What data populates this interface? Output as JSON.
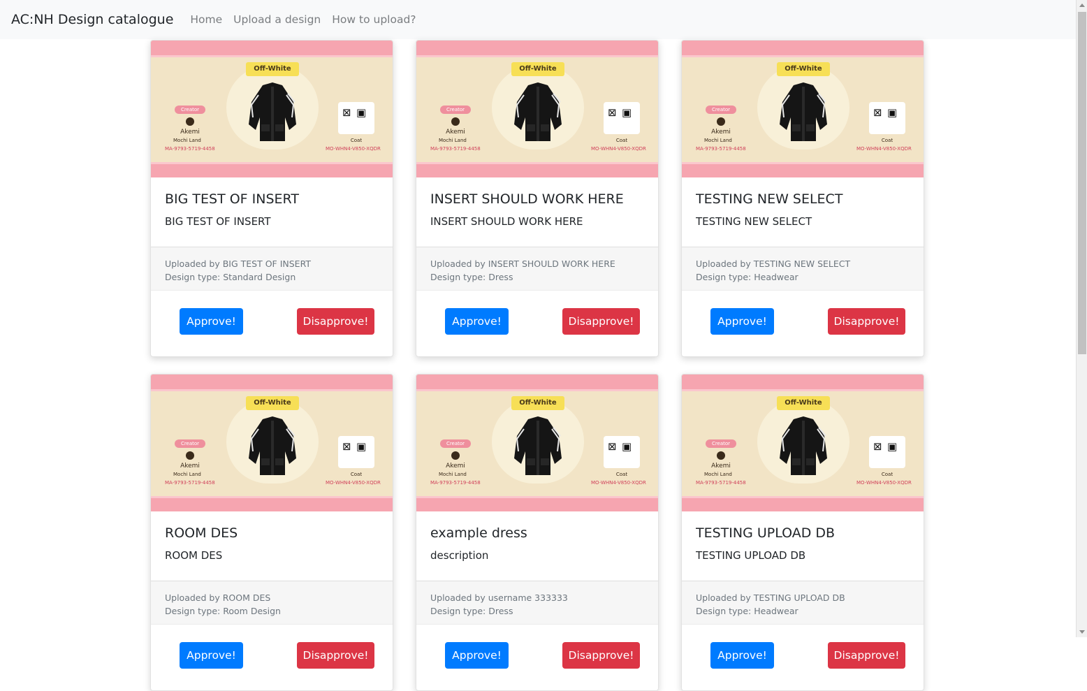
{
  "navbar": {
    "brand": "AC:NH Design catalogue",
    "links": [
      "Home",
      "Upload a design",
      "How to upload?"
    ]
  },
  "design_preview": {
    "brand_tag": "Off-White",
    "creator_label": "Creator",
    "creator_name": "Akemi",
    "island": "Mochi Land",
    "creator_id": "MA-9793-5719-4458",
    "item_type": "Coat",
    "item_id": "MO-WHN4-V850-XQDR"
  },
  "labels": {
    "uploaded_by_prefix": "Uploaded by ",
    "design_type_prefix": "Design type: "
  },
  "buttons": {
    "approve": "Approve!",
    "disapprove": "Disapprove!"
  },
  "colors": {
    "approve": "#007bff",
    "disapprove": "#dc3545",
    "navbar_bg": "#f8f9fa",
    "preview_band": "#f6a5b0",
    "preview_bg": "#f2e4c6"
  },
  "cards": [
    {
      "title": "BIG TEST OF INSERT",
      "description": "BIG TEST OF INSERT",
      "uploader": "BIG TEST OF INSERT",
      "design_type": "Standard Design"
    },
    {
      "title": "INSERT SHOULD WORK HERE",
      "description": "INSERT SHOULD WORK HERE",
      "uploader": "INSERT SHOULD WORK HERE",
      "design_type": "Dress"
    },
    {
      "title": "TESTING NEW SELECT",
      "description": "TESTING NEW SELECT",
      "uploader": "TESTING NEW SELECT",
      "design_type": "Headwear"
    },
    {
      "title": "ROOM DES",
      "description": "ROOM DES",
      "uploader": "ROOM DES",
      "design_type": "Room Design"
    },
    {
      "title": "example dress",
      "description": "description",
      "uploader": "username 333333",
      "design_type": "Dress"
    },
    {
      "title": "TESTING UPLOAD DB",
      "description": "TESTING UPLOAD DB",
      "uploader": "TESTING UPLOAD DB",
      "design_type": "Headwear"
    }
  ]
}
